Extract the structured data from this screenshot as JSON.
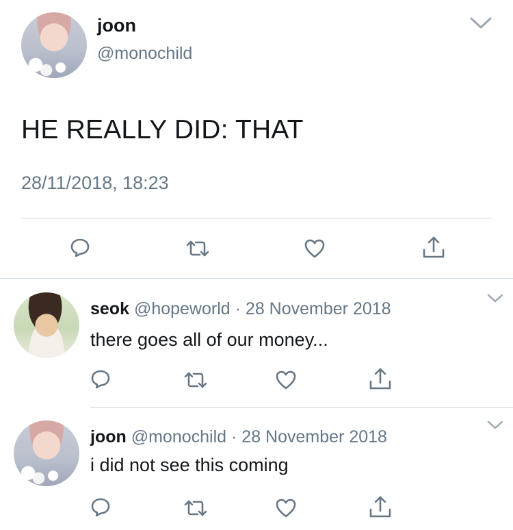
{
  "main_tweet": {
    "name": "joon",
    "handle": "@monochild",
    "text": "HE REALLY DID: THAT",
    "timestamp": "28/11/2018, 18:23",
    "actions": [
      "reply-icon",
      "retweet-icon",
      "like-icon",
      "share-icon"
    ]
  },
  "replies": [
    {
      "name": "seok",
      "handle": "@hopeworld",
      "separator": "·",
      "date": "28 November 2018",
      "text": "there goes all of our money..."
    },
    {
      "name": "joon",
      "handle": "@monochild",
      "separator": "·",
      "date": "28 November 2018",
      "text": "i did not see this coming"
    }
  ],
  "colors": {
    "text": "#14171a",
    "secondary": "#657786",
    "icon": "#657786",
    "divider": "#ccd6dd"
  }
}
